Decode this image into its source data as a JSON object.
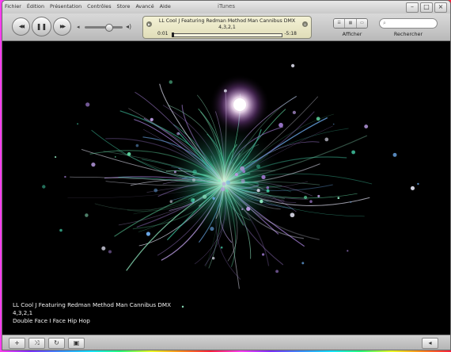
{
  "window": {
    "title": "iTunes",
    "controls": {
      "minimize": "–",
      "maximize": "□",
      "close": "×"
    }
  },
  "menu": [
    "Fichier",
    "Édition",
    "Présentation",
    "Contrôles",
    "Store",
    "Avancé",
    "Aide"
  ],
  "playback": {
    "previous_icon": "◀◀",
    "play_pause_icon": "❚❚",
    "next_icon": "▶▶",
    "volume_level": 0.62
  },
  "now_playing": {
    "title": "LL Cool J Featuring Redman Method Man Cannibus DMX",
    "subtitle": "4,3,2,1",
    "elapsed": "0:01",
    "remaining": "-5:18",
    "progress": 0.003
  },
  "view": {
    "label": "Afficher"
  },
  "search": {
    "label": "Rechercher"
  },
  "visualizer": {
    "track_lines": [
      "LL Cool J Featuring Redman Method Man Cannibus DMX",
      "4,3,2,1",
      "Double Face I Face Hip Hop"
    ]
  },
  "bottom_bar": {
    "add_icon": "+",
    "shuffle_icon": "⤨",
    "repeat_icon": "↻",
    "artwork_icon": "▣",
    "eject_icon": "◂"
  },
  "colors": {
    "accent": "#36d98a",
    "lcd": "#eeecd0"
  }
}
